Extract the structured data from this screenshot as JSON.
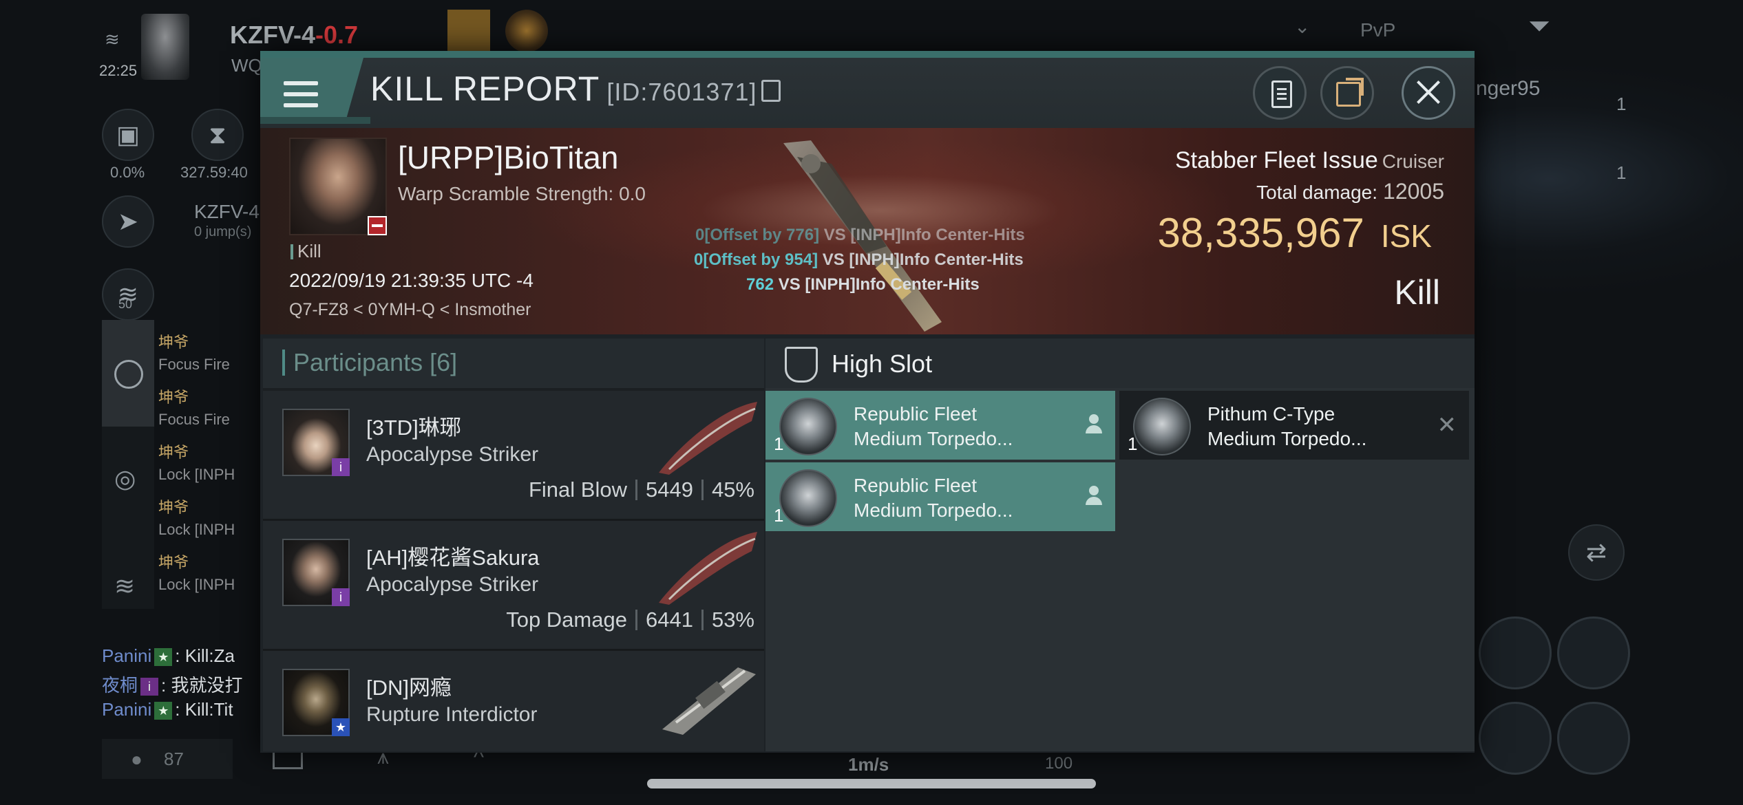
{
  "hud": {
    "system_name": "KZFV-4",
    "security": "-0.7",
    "time": "22:25",
    "corp_ticker": "WQ",
    "cargo_pct": "0.0%",
    "coords": "327.59:40",
    "nav_target": "KZFV-4",
    "nav_jumps": "0 jump(s)",
    "ring_value": "50",
    "right_name": "nger95",
    "right_count_a": "1",
    "right_count_b": "1",
    "filter_mode": "PvP",
    "speed": "1m/s",
    "speed_max": "100",
    "pilot_count": "87",
    "feed": [
      {
        "who": "坤爷",
        "msg": "Focus Fire"
      },
      {
        "who": "坤爷",
        "msg": "Focus Fire"
      },
      {
        "who": "坤爷",
        "msg": "Lock [INPH"
      },
      {
        "who": "坤爷",
        "msg": "Lock [INPH"
      },
      {
        "who": "坤爷",
        "msg": "Lock [INPH"
      }
    ],
    "chat": [
      {
        "name": "Panini",
        "badge": "★",
        "text": ": Kill:Za"
      },
      {
        "name": "夜桐",
        "badge": "i",
        "text": ": 我就没打"
      },
      {
        "name": "Panini",
        "badge": "★",
        "text": ": Kill:Tit"
      }
    ]
  },
  "report": {
    "title": "KILL REPORT",
    "id_label": "[ID:7601371]",
    "victim": {
      "name": "[URPP]BioTitan",
      "warp_scramble": "Warp Scramble Strength: 0.0",
      "tag": "Kill",
      "datetime": "2022/09/19 21:39:35 UTC -4",
      "location": "Q7-FZ8 < 0YMH-Q < Insmother"
    },
    "hits": [
      {
        "num": "0[Offset by 776]",
        "text": " VS [INPH]Info Center-Hits"
      },
      {
        "num": "0[Offset by 954]",
        "text": " VS [INPH]Info Center-Hits"
      },
      {
        "num": "762",
        "text": " VS [INPH]Info Center-Hits"
      }
    ],
    "ship": {
      "name": "Stabber Fleet Issue",
      "class": "Cruiser",
      "total_damage_label": "Total damage:",
      "total_damage": "12005",
      "isk_value": "38,335,967",
      "isk_unit": "ISK",
      "result": "Kill"
    },
    "participants": {
      "label": "Participants",
      "count": "[6]",
      "rows": [
        {
          "name": "[3TD]琳琊",
          "ship": "Apocalypse Striker",
          "stat_label": "Final Blow",
          "damage": "5449",
          "pct": "45%",
          "badge": "i",
          "badge_color": "#7a3ea6"
        },
        {
          "name": "[AH]樱花酱Sakura",
          "ship": "Apocalypse Striker",
          "stat_label": "Top Damage",
          "damage": "6441",
          "pct": "53%",
          "badge": "i",
          "badge_color": "#7a3ea6"
        },
        {
          "name": "[DN]网瘾",
          "ship": "Rupture Interdictor",
          "stat_label": "",
          "damage": "",
          "pct": "",
          "badge": "★",
          "badge_color": "#2a52b8"
        }
      ]
    },
    "high_slot": {
      "label": "High Slot",
      "modules": [
        {
          "line1": "Republic Fleet",
          "line2": "Medium Torpedo...",
          "qty": "1",
          "state": "dropped"
        },
        {
          "line1": "Pithum C-Type",
          "line2": "Medium Torpedo...",
          "qty": "1",
          "state": "destroyed"
        },
        {
          "line1": "Republic Fleet",
          "line2": "Medium Torpedo...",
          "qty": "1",
          "state": "dropped"
        }
      ]
    }
  }
}
